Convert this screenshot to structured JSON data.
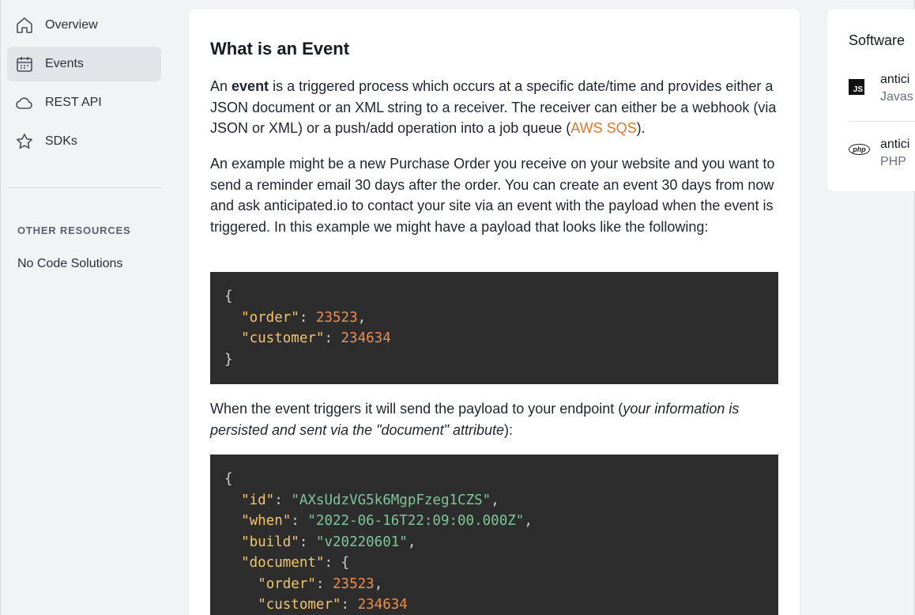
{
  "sidebar": {
    "items": [
      {
        "label": "Overview",
        "icon": "home-icon",
        "active": false
      },
      {
        "label": "Events",
        "icon": "calendar-icon",
        "active": true
      },
      {
        "label": "REST API",
        "icon": "cloud-icon",
        "active": false
      },
      {
        "label": "SDKs",
        "icon": "star-icon",
        "active": false
      }
    ],
    "section_title": "OTHER RESOURCES",
    "resources": [
      "No Code Solutions"
    ]
  },
  "main": {
    "title": "What is an Event",
    "p1": {
      "a": "An ",
      "b": "event",
      "c": " is a triggered process which occurs at a specific date/time and provides either a JSON document or an XML string to a receiver. The receiver can either be a webhook (via JSON or XML) or a push/add operation into a job queue (",
      "link": "AWS SQS",
      "d": ")."
    },
    "p2": "An example might be a new Purchase Order you receive on your website and you want to send a reminder email 30 days after the order. You can create an event 30 days from now and ask anticipated.io to contact your site via an event with the payload when the event is triggered. In this example we might have a payload that looks like the following:",
    "code1": {
      "open": "{",
      "order_key": "\"order\"",
      "order_val": "23523",
      "customer_key": "\"customer\"",
      "customer_val": "234634",
      "close": "}"
    },
    "p3": {
      "a": "When the event triggers it will send the payload to your endpoint (",
      "italic": "your information is persisted and sent via the \"document\" attribute",
      "b": "):"
    },
    "code2": {
      "open": "{",
      "id_key": "\"id\"",
      "id_val": "\"AXsUdzVG5k6MgpFzeg1CZS\"",
      "when_key": "\"when\"",
      "when_val": "\"2022-06-16T22:09:00.000Z\"",
      "build_key": "\"build\"",
      "build_val": "\"v20220601\"",
      "document_key": "\"document\"",
      "doc_open": "{",
      "order_key": "\"order\"",
      "order_val": "23523",
      "customer_key": "\"customer\"",
      "customer_val": "234634"
    }
  },
  "right": {
    "title": "Software",
    "sdks": [
      {
        "name": "antici",
        "lang": "Javas",
        "logo": "javascript-logo"
      },
      {
        "name": "antici",
        "lang": "PHP",
        "logo": "php-logo"
      }
    ]
  },
  "colors": {
    "link": "#e8742c",
    "code_bg": "#2d2d2d",
    "code_key": "#f5c46a",
    "code_number": "#f08d49",
    "code_string": "#7ec699",
    "active_nav": "#e3e4e8"
  }
}
